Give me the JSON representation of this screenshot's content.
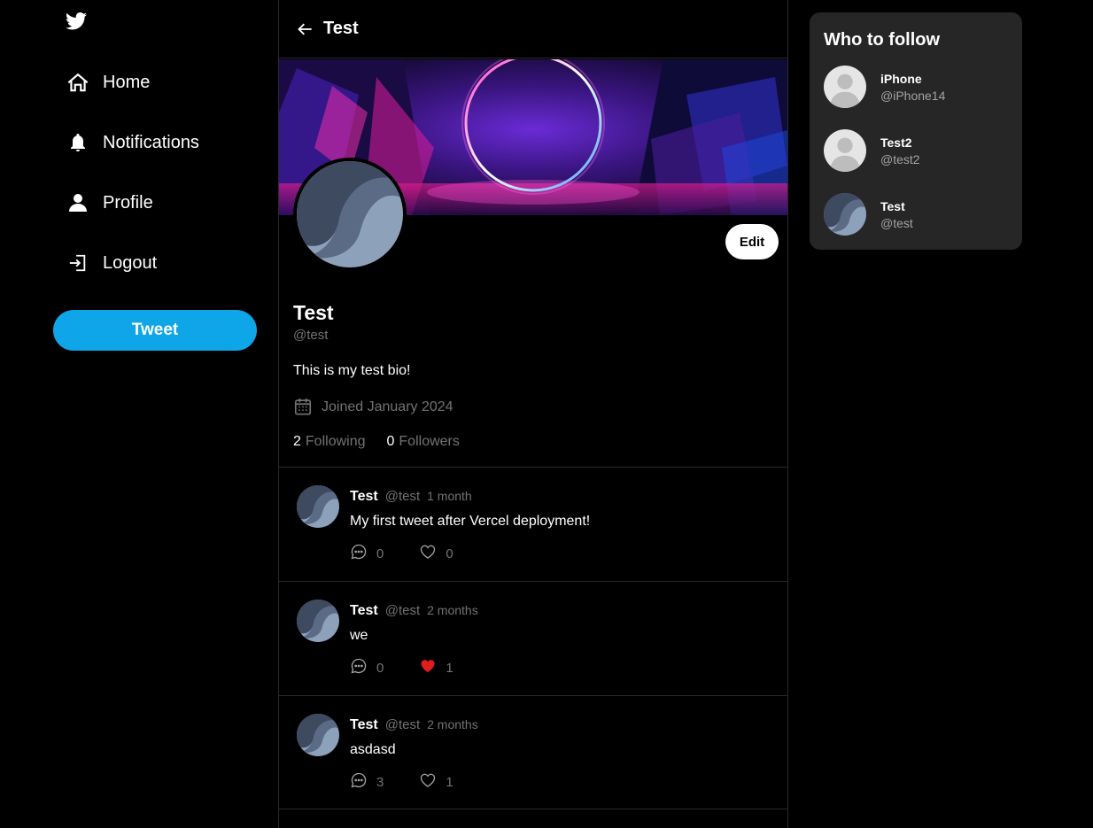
{
  "sidebar": {
    "logo_icon": "twitter-bird-icon",
    "items": [
      {
        "label": "Home",
        "icon": "home-icon"
      },
      {
        "label": "Notifications",
        "icon": "bell-icon"
      },
      {
        "label": "Profile",
        "icon": "user-icon"
      },
      {
        "label": "Logout",
        "icon": "logout-icon"
      }
    ],
    "tweet_label": "Tweet"
  },
  "colors": {
    "accent": "#0ea5e9",
    "like_active": "#e11d1d",
    "muted": "#737373",
    "panel": "#262626"
  },
  "header": {
    "back_icon": "arrow-left-icon",
    "title": "Test"
  },
  "profile": {
    "name": "Test",
    "handle": "@test",
    "bio": "This is my test bio!",
    "joined": "Joined January 2024",
    "edit_label": "Edit",
    "following_count": "2",
    "following_label": "Following",
    "followers_count": "0",
    "followers_label": "Followers"
  },
  "tweets": [
    {
      "name": "Test",
      "handle": "@test",
      "time": "1 month",
      "body": "My first tweet after Vercel deployment!",
      "replies": "0",
      "likes": "0",
      "liked": false
    },
    {
      "name": "Test",
      "handle": "@test",
      "time": "2 months",
      "body": "we",
      "replies": "0",
      "likes": "1",
      "liked": true
    },
    {
      "name": "Test",
      "handle": "@test",
      "time": "2 months",
      "body": "asdasd",
      "replies": "3",
      "likes": "1",
      "liked": false
    }
  ],
  "who_to_follow": {
    "title": "Who to follow",
    "users": [
      {
        "name": "iPhone",
        "handle": "@iPhone14",
        "avatar": "default"
      },
      {
        "name": "Test2",
        "handle": "@test2",
        "avatar": "default"
      },
      {
        "name": "Test",
        "handle": "@test",
        "avatar": "wave"
      }
    ]
  }
}
